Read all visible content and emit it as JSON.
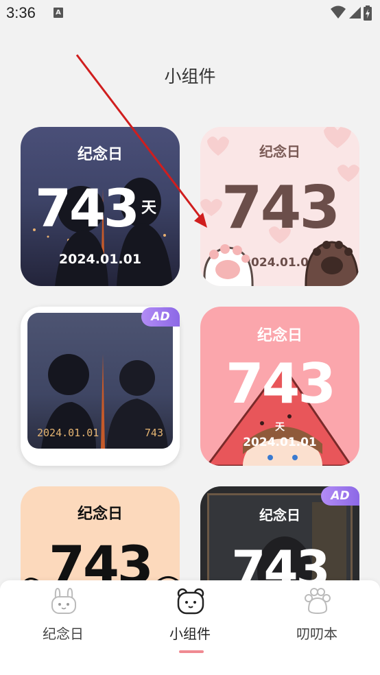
{
  "status_bar": {
    "time": "3:36",
    "notification_letter": "A"
  },
  "page": {
    "title": "小组件"
  },
  "widgets": [
    {
      "label": "纪念日",
      "days": "743",
      "unit": "天",
      "date": "2024.01.01"
    },
    {
      "label": "纪念日",
      "days": "743",
      "date": "2024.01.01"
    },
    {
      "ad_badge": "AD",
      "date": "2024.01.01",
      "days": "743"
    },
    {
      "label": "纪念日",
      "days": "743",
      "unit": "天",
      "date": "2024.01.01"
    },
    {
      "label": "纪念日",
      "days": "743"
    },
    {
      "ad_badge": "AD",
      "label": "纪念日",
      "days": "743"
    }
  ],
  "tabs": [
    {
      "label": "纪念日",
      "icon": "bunny-icon",
      "active": false
    },
    {
      "label": "小组件",
      "icon": "bear-icon",
      "active": true
    },
    {
      "label": "叨叨本",
      "icon": "paw-icon",
      "active": false
    }
  ],
  "colors": {
    "background": "#f2f2f2",
    "accent_indicator": "#f08a92",
    "ad_badge": "#9a76ec",
    "annotation_arrow": "#d01e1e"
  }
}
